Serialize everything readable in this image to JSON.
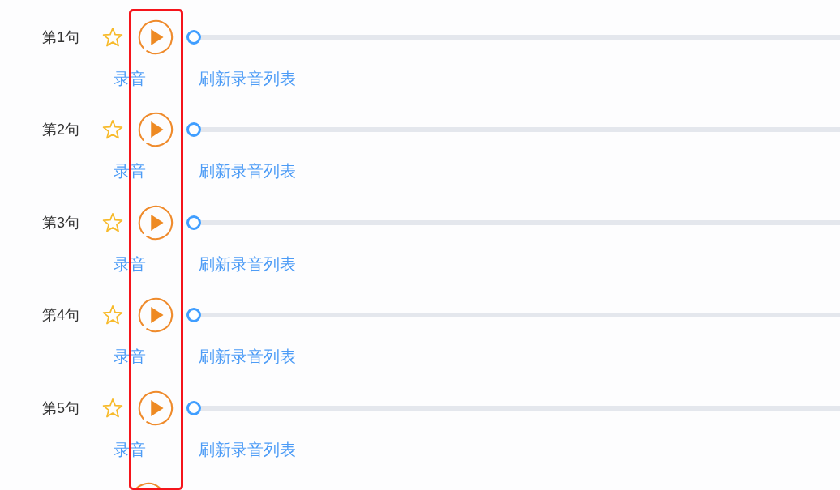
{
  "sentences": [
    {
      "kind": "full",
      "label": "第1句",
      "favorite": false,
      "level": 0,
      "record": "录音",
      "refresh": "刷新录音列表"
    },
    {
      "kind": "full",
      "label": "第2句",
      "favorite": false,
      "level": 0,
      "record": "录音",
      "refresh": "刷新录音列表"
    },
    {
      "kind": "full",
      "label": "第3句",
      "favorite": false,
      "level": 0,
      "record": "录音",
      "refresh": "刷新录音列表"
    },
    {
      "kind": "full",
      "label": "第4句",
      "favorite": false,
      "level": 0,
      "record": "录音",
      "refresh": "刷新录音列表"
    },
    {
      "kind": "full",
      "label": "第5句",
      "favorite": false,
      "level": 0,
      "record": "录音",
      "refresh": "刷新录音列表"
    },
    {
      "kind": "partial"
    }
  ]
}
